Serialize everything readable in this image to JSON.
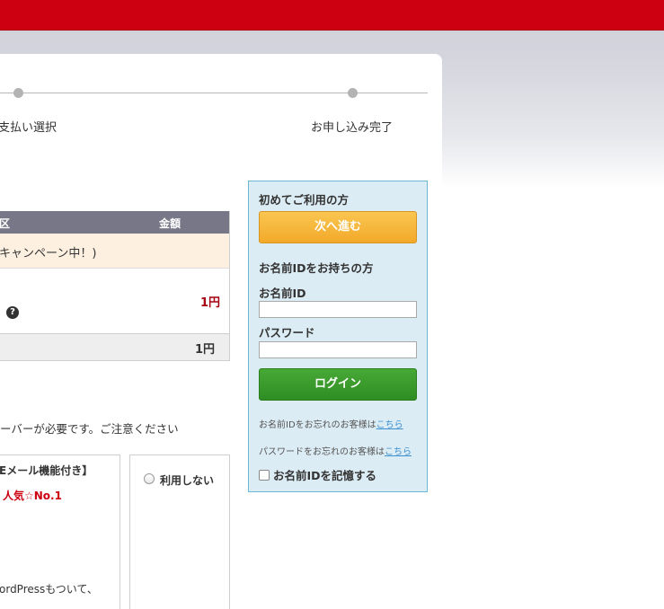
{
  "steps": {
    "payment_label": "支払い選択",
    "complete_label": "お申し込み完了"
  },
  "price_table": {
    "col_item": "区",
    "col_amount": "金額",
    "campaign": "キャンペーン中！)",
    "item_price": "1円",
    "total_price": "1円"
  },
  "notice": "ーバーが必要です。ご注意ください",
  "options": {
    "mail_title": "Eメール機能付き】",
    "mail_badge": "人気☆No.1",
    "mail_desc": "ordPressもついて、",
    "none_label": "利用しない"
  },
  "login": {
    "first_time_title": "初めてご利用の方",
    "next_button": "次へ進む",
    "member_title": "お名前IDをお持ちの方",
    "id_label": "お名前ID",
    "password_label": "パスワード",
    "login_button": "ログイン",
    "forgot_id_text": "お名前IDをお忘れのお客様は",
    "forgot_password_text": "パスワードをお忘れのお客様は",
    "link_text": "こちら",
    "remember_label": "お名前IDを記憶する"
  },
  "colors": {
    "brand_red": "#cc0011",
    "next_orange": "#f5b43a",
    "login_green": "#389a2a",
    "login_box_bg": "#dcecf4"
  }
}
